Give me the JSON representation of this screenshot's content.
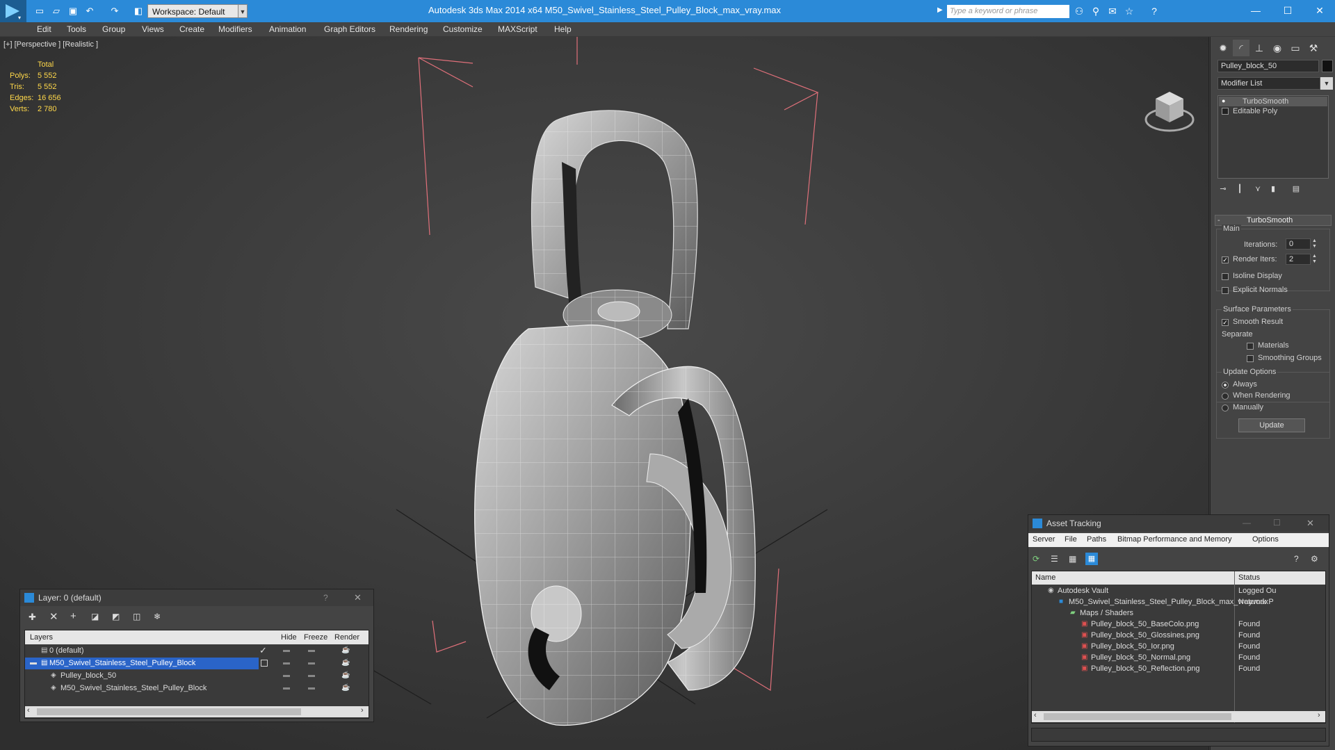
{
  "titlebar": {
    "workspace": "Workspace: Default",
    "app_title": "Autodesk 3ds Max  2014 x64      M50_Swivel_Stainless_Steel_Pulley_Block_max_vray.max",
    "search_placeholder": "Type a keyword or phrase"
  },
  "menu": [
    "Edit",
    "Tools",
    "Group",
    "Views",
    "Create",
    "Modifiers",
    "Animation",
    "Graph Editors",
    "Rendering",
    "Customize",
    "MAXScript",
    "Help"
  ],
  "viewport": {
    "label": "[+] [Perspective ] [Realistic ]",
    "stats_header": "Total",
    "stats": [
      {
        "label": "Polys:",
        "value": "5 552"
      },
      {
        "label": "Tris:",
        "value": "5 552"
      },
      {
        "label": "Edges:",
        "value": "16 656"
      },
      {
        "label": "Verts:",
        "value": "2 780"
      }
    ]
  },
  "command_panel": {
    "object_name": "Pulley_block_50",
    "modifier_list": "Modifier List",
    "stack": [
      "TurboSmooth",
      "Editable Poly"
    ],
    "rollout_title": "TurboSmooth",
    "main_label": "Main",
    "iterations_label": "Iterations:",
    "iterations_value": "0",
    "render_iters_label": "Render Iters:",
    "render_iters_value": "2",
    "isoline": "Isoline Display",
    "explicit": "Explicit Normals",
    "surface_params": "Surface Parameters",
    "smooth_result": "Smooth Result",
    "separate": "Separate",
    "materials": "Materials",
    "smoothing_groups": "Smoothing Groups",
    "update_options": "Update Options",
    "always": "Always",
    "when_rendering": "When Rendering",
    "manually": "Manually",
    "update_btn": "Update"
  },
  "layer_window": {
    "title": "Layer: 0 (default)",
    "help": "?",
    "columns": [
      "Layers",
      "Hide",
      "Freeze",
      "Render"
    ],
    "rows": [
      {
        "name": "0 (default)"
      },
      {
        "name": "M50_Swivel_Stainless_Steel_Pulley_Block"
      },
      {
        "name": "Pulley_block_50"
      },
      {
        "name": "M50_Swivel_Stainless_Steel_Pulley_Block"
      }
    ]
  },
  "asset_window": {
    "title": "Asset Tracking",
    "menu": [
      "Server",
      "File",
      "Paths",
      "Bitmap Performance and Memory",
      "Options"
    ],
    "col_name": "Name",
    "col_status": "Status",
    "rows": [
      {
        "name": "Autodesk Vault",
        "status": "Logged Ou"
      },
      {
        "name": "M50_Swivel_Stainless_Steel_Pulley_Block_max_vray.max",
        "status": "Network P"
      },
      {
        "name": "Maps / Shaders",
        "status": ""
      },
      {
        "name": "Pulley_block_50_BaseColo.png",
        "status": "Found"
      },
      {
        "name": "Pulley_block_50_Glossines.png",
        "status": "Found"
      },
      {
        "name": "Pulley_block_50_Ior.png",
        "status": "Found"
      },
      {
        "name": "Pulley_block_50_Normal.png",
        "status": "Found"
      },
      {
        "name": "Pulley_block_50_Reflection.png",
        "status": "Found"
      }
    ]
  },
  "colors": {
    "accent": "#2b8ad8",
    "selection": "#2a64c8",
    "stats": "#ffd84a",
    "bbox": "#e0707a"
  }
}
